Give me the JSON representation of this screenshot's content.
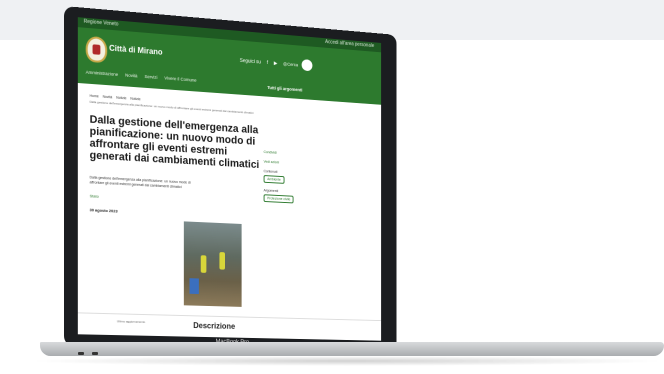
{
  "header_top": {
    "left": "Regione Veneto",
    "right": "Accedi all'area personale"
  },
  "header": {
    "city_name": "Città di Mirano",
    "nav": [
      "Amministrazione",
      "Novità",
      "Servizi",
      "Vivere il Comune"
    ],
    "social_label": "Seguici su",
    "social_icons": [
      "f",
      "▶",
      "◎"
    ],
    "search_label": "Cerca",
    "all_topics": "Tutti gli argomenti"
  },
  "breadcrumb": [
    "Home",
    "Novità",
    "Notizie",
    "Notizie"
  ],
  "breadcrumb_sub": "Dalla gestione dell'emergenza alla pianificazione: un nuovo modo di affrontare gli eventi estremi generati dai cambiamenti climatici",
  "article": {
    "title": "Dalla gestione dell'emergenza alla pianificazione: un nuovo modo di affrontare gli eventi estremi generati dai cambiamenti climatici",
    "description": "Dalla gestione dell'emergenza alla pianificazione: un nuovo modo di affrontare gli eventi estremi generati dai cambiamenti climatici",
    "tag": "Stato",
    "date": "30 agosto 2023"
  },
  "sidebar": {
    "link1": "Condividi",
    "link2": "Vedi azioni",
    "label": "Contenuti",
    "btn1": "Ambiente",
    "label2": "Argomenti",
    "btn2": "Protezione civile"
  },
  "footer": {
    "left": "Ultimo aggiornamento",
    "right": "Descrizione"
  },
  "device_label": "MacBook Pro"
}
